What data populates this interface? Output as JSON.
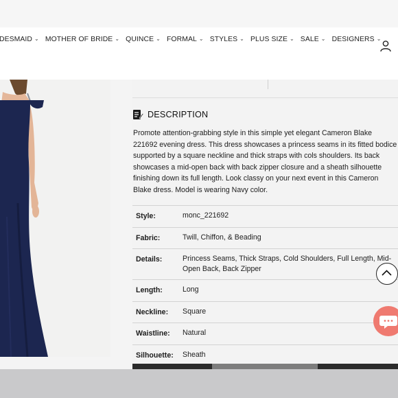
{
  "nav": {
    "items": [
      {
        "label": "IDESMAID"
      },
      {
        "label": "MOTHER OF BRIDE"
      },
      {
        "label": "QUINCE"
      },
      {
        "label": "FORMAL"
      },
      {
        "label": "STYLES"
      },
      {
        "label": "PLUS SIZE"
      },
      {
        "label": "SALE"
      },
      {
        "label": "DESIGNERS"
      }
    ],
    "account_icon": "user-icon"
  },
  "description": {
    "icon": "note-edit-icon",
    "title": "DESCRIPTION",
    "text": "Promote attention-grabbing style in this simple yet elegant Cameron Blake 221692 evening dress. This dress showcases a princess seams in its fitted bodice supported by a square neckline and thick straps with cols shoulders. Its back showcases a mid-open back with back zipper closure and a sheath silhouette finishing down its full length. Look classy on your next event in this Cameron Blake dress. Model is wearing Navy color."
  },
  "specs": [
    {
      "key": "Style:",
      "value": "monc_221692"
    },
    {
      "key": "Fabric:",
      "value": "Twill, Chiffon, & Beading"
    },
    {
      "key": "Details:",
      "value": "Princess Seams, Thick Straps, Cold Shoulders, Full Length, Mid-Open Back, Back Zipper"
    },
    {
      "key": "Length:",
      "value": "Long"
    },
    {
      "key": "Neckline:",
      "value": "Square"
    },
    {
      "key": "Waistline:",
      "value": "Natural"
    },
    {
      "key": "Silhouette:",
      "value": "Sheath"
    }
  ],
  "widgets": {
    "scroll_top_icon": "chevron-up-icon",
    "chat_icon": "chat-bubble-icon",
    "chat_color": "#ef7a70"
  },
  "product": {
    "dress_color": "#1c2650"
  }
}
